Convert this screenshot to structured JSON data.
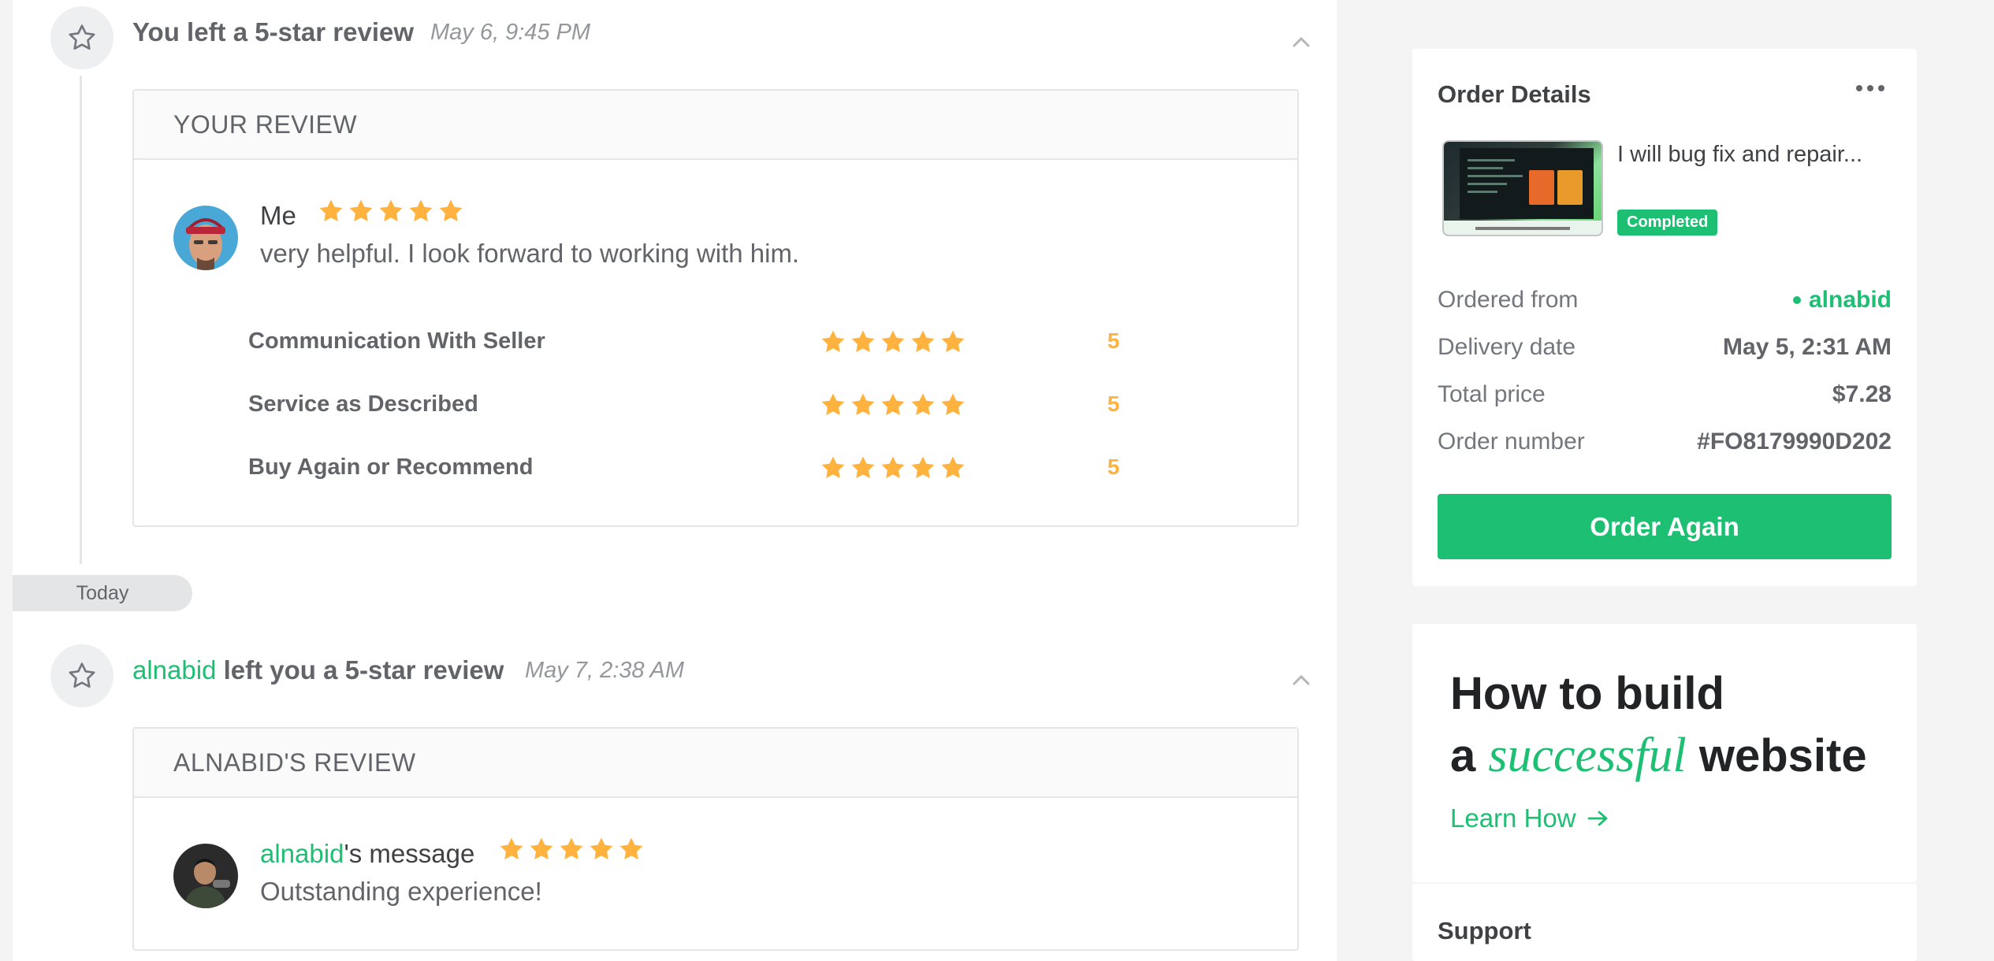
{
  "events": [
    {
      "title": "You left a 5-star review",
      "time": "May 6, 9:45 PM",
      "card_header": "YOUR REVIEW",
      "reviewer": "Me",
      "text": "very helpful. I look forward to working with him.",
      "ratings": [
        {
          "label": "Communication With Seller",
          "value": "5"
        },
        {
          "label": "Service as Described",
          "value": "5"
        },
        {
          "label": "Buy Again or Recommend",
          "value": "5"
        }
      ]
    },
    {
      "user": "alnabid",
      "title_rest": " left you a 5-star review",
      "time": "May 7, 2:38 AM",
      "card_header": "ALNABID'S REVIEW",
      "reviewer_user": "alnabid",
      "reviewer_suffix": "'s message",
      "text": "Outstanding experience!"
    }
  ],
  "star_rating": 5,
  "divider_label": "Today",
  "order_details": {
    "title": "Order Details",
    "gig_title": "I will bug fix and repair...",
    "status": "Completed",
    "rows": [
      {
        "label": "Ordered from",
        "value": "alnabid"
      },
      {
        "label": "Delivery date",
        "value": "May 5, 2:31 AM"
      },
      {
        "label": "Total price",
        "value": "$7.28"
      },
      {
        "label": "Order number",
        "value": "#FO8179990D202"
      }
    ],
    "order_again_label": "Order Again"
  },
  "promo": {
    "line1": "How to build",
    "line2_prefix": "a ",
    "accent": "successful",
    "line2_suffix": " website",
    "link_label": "Learn How"
  },
  "support": {
    "title": "Support"
  },
  "colors": {
    "brand_green": "#1dbf73",
    "star_yellow": "#ffb33e",
    "text_dark": "#404145",
    "text_muted": "#62646a"
  },
  "icons": [
    "star-outline-icon",
    "chevron-up-icon",
    "star-icon",
    "more-icon",
    "arrow-right-icon"
  ]
}
